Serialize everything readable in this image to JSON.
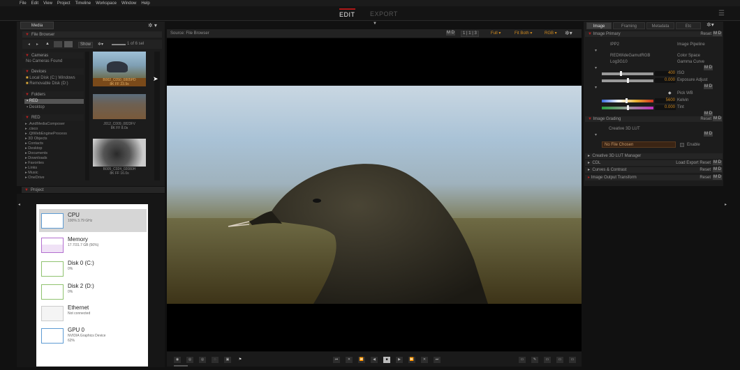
{
  "menu": [
    "File",
    "Edit",
    "View",
    "Project",
    "Timeline",
    "Workspace",
    "Window",
    "Help"
  ],
  "modes": {
    "edit": "EDIT",
    "export": "EXPORT"
  },
  "left": {
    "media_tab": "Media",
    "file_browser": "File Browser",
    "show_label": "Show",
    "count_label": "1 of 6 sel",
    "cameras": {
      "title": "Cameras",
      "empty": "No Cameras Found"
    },
    "devices": {
      "title": "Devices",
      "items": [
        "Local Disk (C:) Windows",
        "Removable Disk (D:)"
      ]
    },
    "folders": {
      "title": "Folders",
      "items": [
        "RED",
        "Desktop"
      ]
    },
    "red": {
      "title": "RED",
      "items": [
        ".AvidMediaComposer",
        ".cisco",
        ".QtWebEngineProcess",
        "3D Objects",
        "Contacts",
        "Desktop",
        "Documents",
        "Downloads",
        "Favorites",
        "Links",
        "Music",
        "OneDrive"
      ]
    },
    "thumbs": [
      {
        "name": "B002_C050_0805PD",
        "meta": "8K FF   23.9s"
      },
      {
        "name": "J012_C009_0823FV",
        "meta": "8K FF   8.0s"
      },
      {
        "name": "B005_C024_02080H",
        "meta": "8K FF   16.0s"
      }
    ]
  },
  "project": {
    "title": "Project"
  },
  "taskmgr": [
    {
      "name": "CPU",
      "sub": "100%  3.79 GHz"
    },
    {
      "name": "Memory",
      "sub": "17.7/31.7 GB (56%)"
    },
    {
      "name": "Disk 0 (C:)",
      "sub": "0%"
    },
    {
      "name": "Disk 2 (D:)",
      "sub": "0%"
    },
    {
      "name": "Ethernet",
      "sub": "Not connected"
    },
    {
      "name": "GPU 0",
      "sub": "NVIDIA Graphics Device\n62%"
    }
  ],
  "viewer": {
    "source": "Source: File Browser",
    "full": "Full",
    "fit": "Fit Both",
    "rgb": "RGB",
    "md": "M D",
    "ratio": "1 | 1 | 3"
  },
  "right": {
    "tabs": [
      "Image",
      "Framing",
      "Metadata",
      "Etc"
    ],
    "primary": {
      "title": "Image  Primary",
      "reset": "Reset",
      "ipp2": "IPP2",
      "pipeline": "Image Pipeline",
      "colorspace_val": "REDWideGamutRGB",
      "colorspace": "Color Space",
      "gamma_val": "Log3G10",
      "gamma": "Gamma Curve",
      "iso_val": "400",
      "iso": "ISO",
      "exposure_val": "0.000",
      "exposure": "Exposure Adjust",
      "pickwb": "Pick WB",
      "kelvin_val": "5600",
      "kelvin": "Kelvin",
      "tint_val": "0.000",
      "tint": "Tint"
    },
    "grading": {
      "title": "Image  Grading",
      "reset": "Reset",
      "lut": "Creative 3D LUT",
      "nofile": "No File Chosen",
      "enable": "Enable"
    },
    "rows": [
      {
        "label": "Creative 3D LUT Manager",
        "right": ""
      },
      {
        "label": "CDL",
        "right": "Load  Export  Reset"
      },
      {
        "label": "Curves & Contrast",
        "right": "Reset"
      },
      {
        "label": "Image  Output Transform",
        "right": "Reset"
      }
    ]
  },
  "colors": {
    "accent": "#b52020",
    "value": "#d08a20",
    "bg": "#111111"
  }
}
